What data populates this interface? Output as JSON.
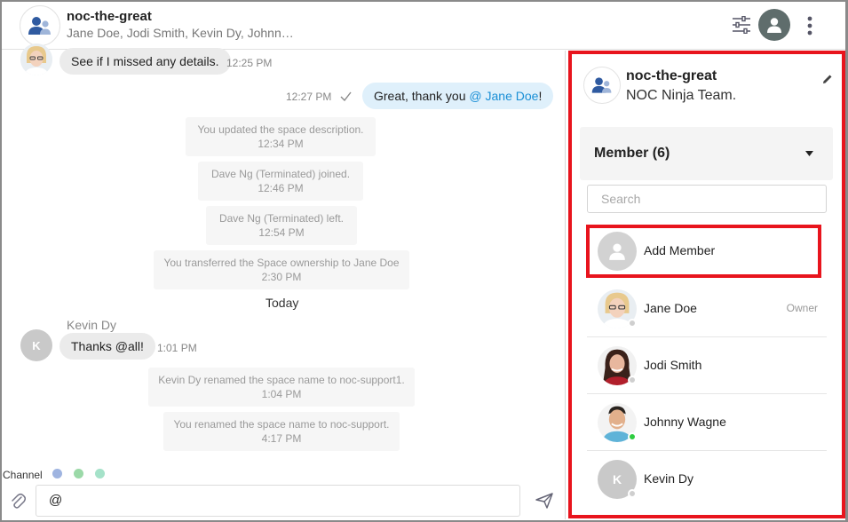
{
  "header": {
    "title": "noc-the-great",
    "participants": "Jane Doe, Jodi Smith, Kevin Dy, Johnn…"
  },
  "messages": [
    {
      "type": "incoming",
      "text": "See if I missed any details.",
      "time": "12:25 PM"
    },
    {
      "type": "outgoing",
      "text_prefix": "Great, thank you ",
      "mention": "@ Jane Doe",
      "text_suffix": "!",
      "time": "12:27 PM"
    },
    {
      "type": "system",
      "text": "You updated the space description.",
      "time": "12:34 PM"
    },
    {
      "type": "system",
      "text": "Dave Ng (Terminated) joined.",
      "time": "12:46 PM"
    },
    {
      "type": "system",
      "text": "Dave Ng (Terminated) left.",
      "time": "12:54 PM"
    },
    {
      "type": "system",
      "text": "You transferred the Space ownership to Jane Doe",
      "time": "2:30 PM"
    },
    {
      "type": "divider",
      "text": "Today"
    },
    {
      "type": "incoming",
      "sender": "Kevin Dy",
      "avatar_initial": "K",
      "text": "Thanks @all!",
      "time": "1:01 PM"
    },
    {
      "type": "system",
      "text": "Kevin Dy renamed the space name to noc-support1.",
      "time": "1:04 PM"
    },
    {
      "type": "system",
      "text": "You renamed the space name to noc-support.",
      "time": "4:17 PM"
    }
  ],
  "composer": {
    "channel_label": "Channel",
    "input_value": "@"
  },
  "panel": {
    "title": "noc-the-great",
    "description": "NOC Ninja Team.",
    "member_header": "Member (6)",
    "search_placeholder": "Search",
    "add_member_label": "Add Member",
    "members": [
      {
        "name": "Jane Doe",
        "role": "Owner",
        "status": "offline"
      },
      {
        "name": "Jodi Smith",
        "role": "",
        "status": "offline"
      },
      {
        "name": "Johnny Wagne",
        "role": "",
        "status": "online"
      },
      {
        "name": "Kevin Dy",
        "role": "",
        "initial": "K",
        "status": "offline"
      }
    ]
  },
  "colors": {
    "accent": "#1a8fd6",
    "highlight_border": "#e8141d",
    "online": "#2ecc40",
    "offline": "#cfcfcf"
  }
}
